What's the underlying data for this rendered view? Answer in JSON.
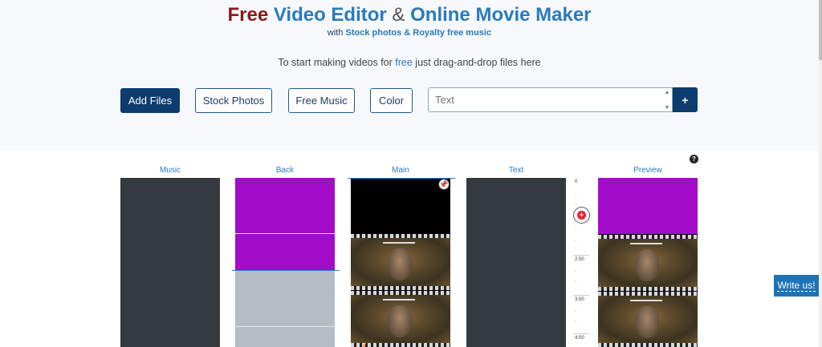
{
  "header": {
    "title_free": "Free",
    "title_video_editor": "Video Editor",
    "title_amp": "&",
    "title_online_movie_maker": "Online Movie Maker",
    "subtitle_prefix": "with",
    "subtitle_links": "Stock photos & Royalty free music",
    "hint_prefix": "To start making videos for",
    "hint_free": "free",
    "hint_suffix": "just drag-and-drop files here"
  },
  "toolbar": {
    "add_files": "Add Files",
    "stock_photos": "Stock Photos",
    "free_music": "Free Music",
    "color": "Color",
    "text_placeholder": "Text",
    "plus": "+"
  },
  "help_icon": "?",
  "columns": {
    "music": "Music",
    "back": "Back",
    "main": "Main",
    "text": "Text",
    "preview": "Preview"
  },
  "ruler": {
    "labels": [
      "0",
      "2:00",
      "3:00",
      "4:00"
    ]
  },
  "feedback": {
    "label": "Write us!"
  },
  "colors": {
    "accent": "#2a7bbd",
    "brand_dark": "#0d3c6e",
    "free_red": "#8b1a1a",
    "clip_purple": "#a20cc8",
    "track_dark": "#353a40",
    "waveform": "#ff6a13"
  },
  "icons": {
    "pin": "pin-icon",
    "zoom": "zoom-in-icon",
    "help": "help-icon"
  }
}
